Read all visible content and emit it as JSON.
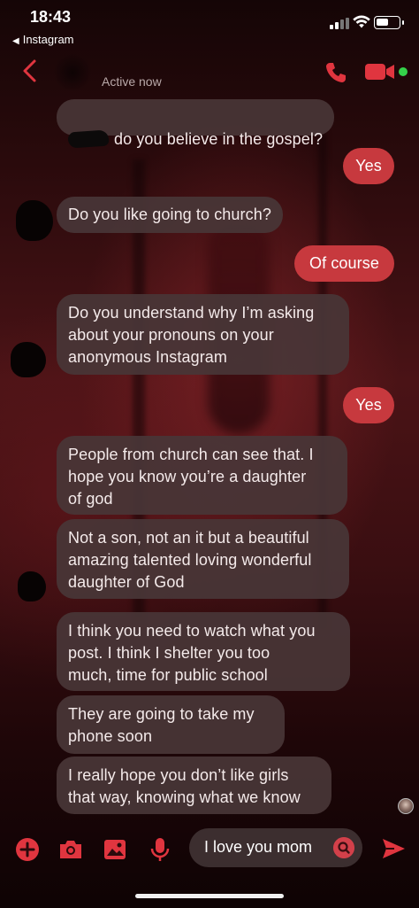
{
  "status_bar": {
    "time": "18:43",
    "back_app": "Instagram",
    "back_arrow": "◀"
  },
  "header": {
    "status": "Active now",
    "accent_color": "#e0353f",
    "online_color": "#35d14a",
    "icons": [
      "back-chevron-icon",
      "phone-icon",
      "video-camera-icon"
    ]
  },
  "messages": [
    {
      "from": "them",
      "text": "do you believe in the gospel?"
    },
    {
      "from": "me",
      "text": "Yes"
    },
    {
      "from": "them",
      "text": "Do you like going to church?"
    },
    {
      "from": "me",
      "text": "Of course"
    },
    {
      "from": "them",
      "text": "Do you understand why I’m asking\nabout your pronouns on your\nanonymous Instagram"
    },
    {
      "from": "me",
      "text": "Yes"
    },
    {
      "from": "them",
      "text": "People from church can see that. I\nhope you know you’re a daughter\nof god"
    },
    {
      "from": "them",
      "text": "Not a son, not an it but a beautiful\namazing talented loving wonderful\ndaughter of God"
    },
    {
      "from": "them",
      "text": "I think you need to watch what you\npost. I think I shelter you too\nmuch, time for public school"
    },
    {
      "from": "them",
      "text": "They are going to take my\nphone soon"
    },
    {
      "from": "them",
      "text": "I really hope you don’t like girls\nthat way, knowing what we know"
    }
  ],
  "composer": {
    "input_value": "I love you mom",
    "icons": [
      "add-icon",
      "camera-icon",
      "gallery-icon",
      "microphone-icon",
      "search-icon",
      "send-icon"
    ]
  }
}
